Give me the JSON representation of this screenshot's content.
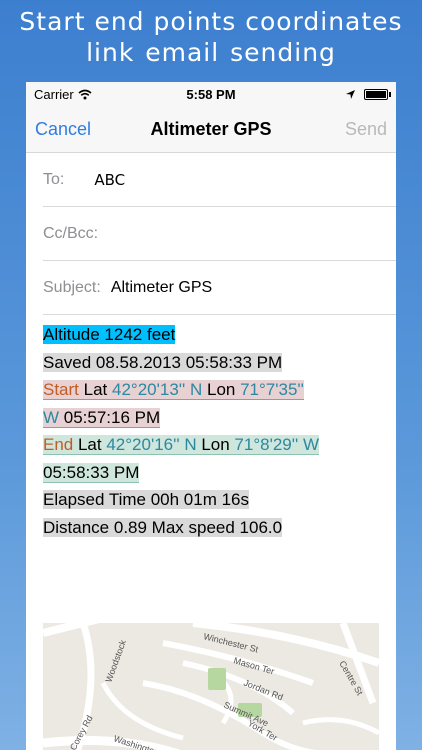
{
  "banner": {
    "line1": "Start end points coordinates",
    "line2": "link email sending"
  },
  "status_bar": {
    "carrier": "Carrier",
    "time": "5:58 PM"
  },
  "nav": {
    "cancel": "Cancel",
    "title": "Altimeter GPS",
    "send": "Send"
  },
  "fields": {
    "to_label": "To:",
    "to_value": "ABC",
    "ccbcc_label": "Cc/Bcc:",
    "subject_label": "Subject:",
    "subject_value": "Altimeter GPS"
  },
  "email_body": {
    "altitude": "Altitude  1242 feet",
    "saved": "Saved 08.58.2013     05:58:33 PM",
    "start_word": "Start",
    "start_lat_label": " Lat ",
    "start_lat": "42°20'13'' N",
    "start_lon_label": "  Lon ",
    "start_lon": "71°7'35''",
    "start_lon_dir": "W",
    "start_time": "  05:57:16 PM",
    "end_word": "End",
    "end_lat_label": " Lat ",
    "end_lat": "42°20'16'' N",
    "end_lon_label": "  Lon ",
    "end_lon": "71°8'29'' W",
    "end_time": "05:58:33 PM",
    "elapsed": "Elapsed Time 00h 01m 16s",
    "distance": "Distance 0.89   Max speed 106.0"
  },
  "map": {
    "streets": [
      "Winchester St",
      "Mason Ter",
      "Jordan Rd",
      "Summit Ave",
      "York Ter",
      "Corey Rd",
      "Washington",
      "Centre St",
      "Woodstock"
    ]
  },
  "colors": {
    "link_blue": "#2f7de1",
    "altitude_highlight": "#00bfff",
    "start_highlight": "#e8d1d3",
    "end_highlight": "#cfe6dc",
    "label_orange": "#c25c24",
    "coord_teal": "#2c88a0"
  }
}
